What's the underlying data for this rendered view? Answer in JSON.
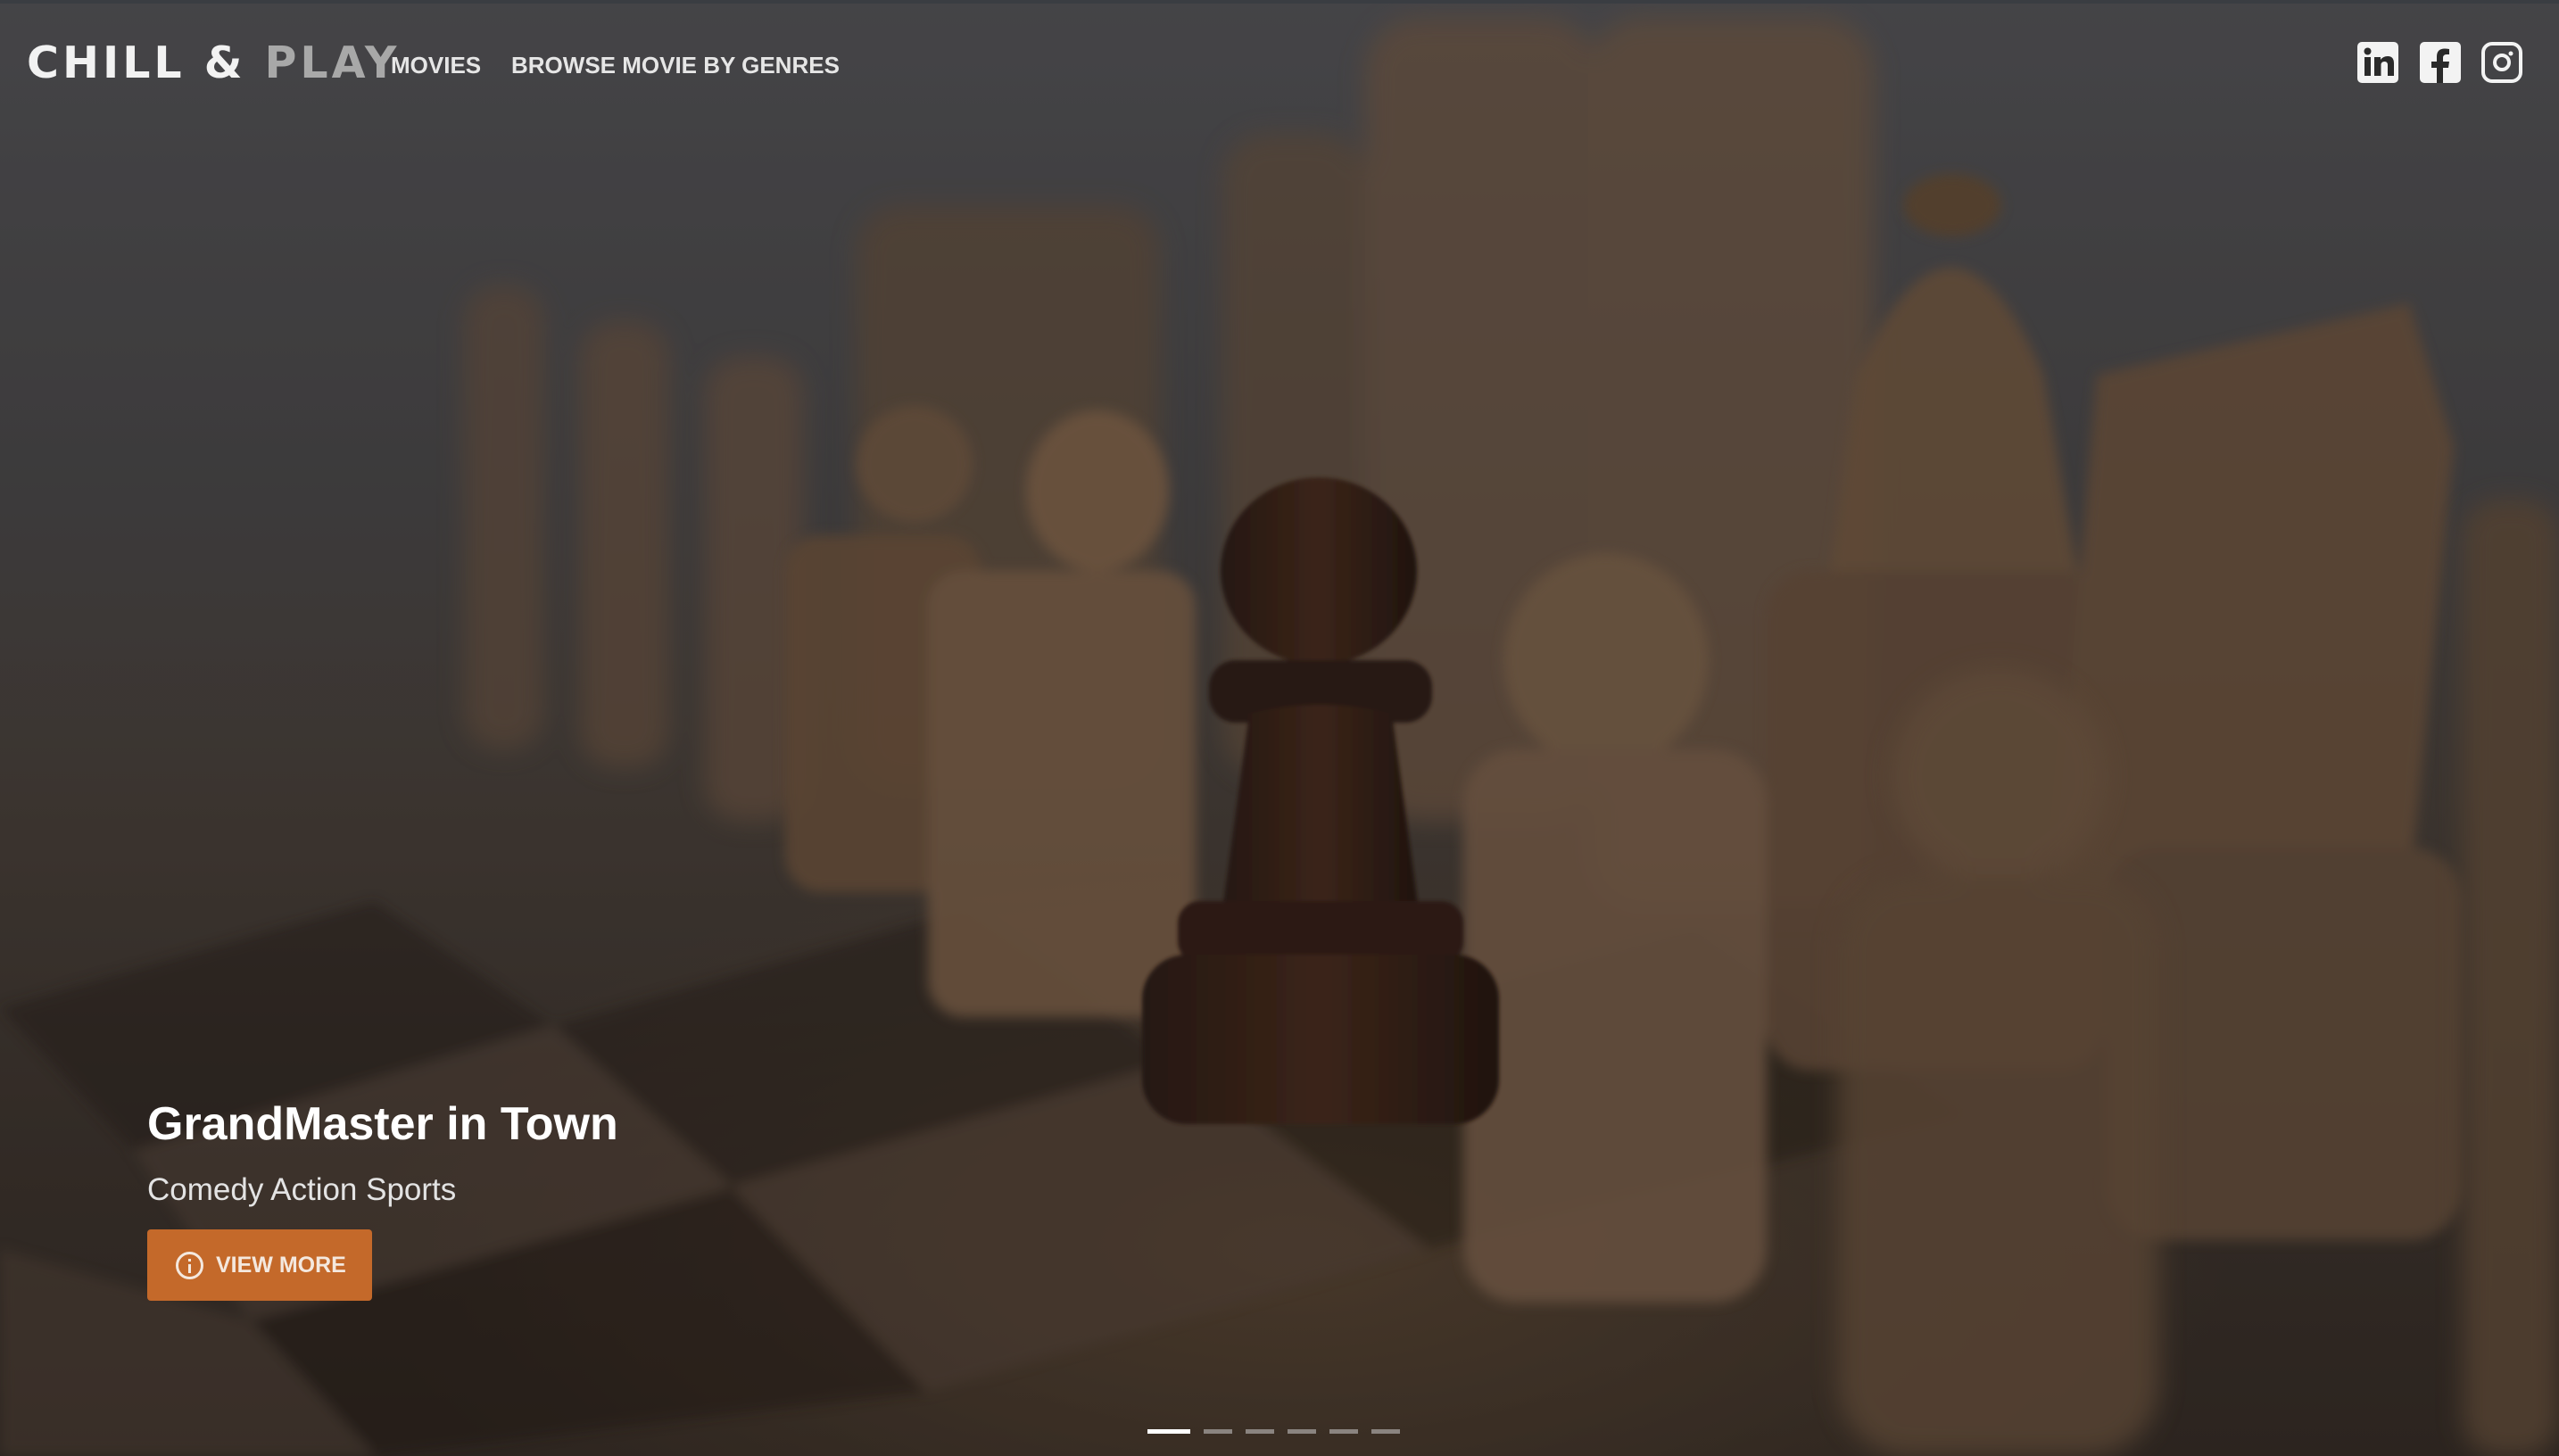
{
  "brand": {
    "part1": "CHILL &",
    "part2": "PLAY"
  },
  "nav": {
    "movies": "MOVIES",
    "genres": "BROWSE MOVIE BY GENRES"
  },
  "social": [
    "linkedin-icon",
    "facebook-icon",
    "instagram-icon"
  ],
  "hero": {
    "title": "GrandMaster in Town",
    "genres": "Comedy Action Sports",
    "button_label": "VIEW MORE",
    "button_icon": "info-icon",
    "button_color": "#c4692a"
  },
  "carousel": {
    "slides": 6,
    "active": 1
  }
}
